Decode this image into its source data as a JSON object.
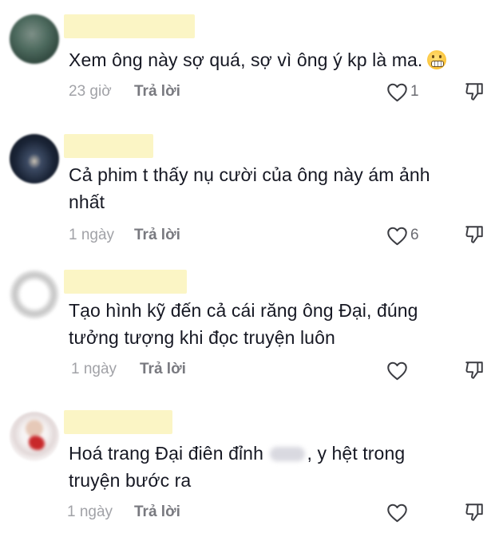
{
  "comments": [
    {
      "text": "Xem ông này sợ quá, sợ vì ông ý kp là ma.",
      "emoji": "grimacing-face",
      "time": "23 giờ",
      "reply_label": "Trả lời",
      "likes": "1"
    },
    {
      "text_line1": "Cả phim t thấy nụ cười của ông này ám ảnh",
      "text_line2": "nhất",
      "time": "1 ngày",
      "reply_label": "Trả lời",
      "likes": "6"
    },
    {
      "text_line1": "Tạo hình kỹ đến cả cái răng ông Đại, đúng",
      "text_line2": "tưởng tượng khi đọc truyện luôn",
      "time": "1 ngày",
      "reply_label": "Trả lời",
      "likes": ""
    },
    {
      "text_before_blur": "Hoá trang Đại điên đỉnh",
      "text_after_blur": ", y hệt trong",
      "text_line2": "truyện bước ra",
      "time": "1 ngày",
      "reply_label": "Trả lời",
      "likes": ""
    }
  ],
  "colors": {
    "text": "#161823",
    "meta_time": "#a1a2a7",
    "reply": "#78797f",
    "name_redaction": "#fbf5c5"
  },
  "icons": [
    "heart-outline-icon",
    "thumb-down-icon",
    "grimacing-face-emoji"
  ]
}
